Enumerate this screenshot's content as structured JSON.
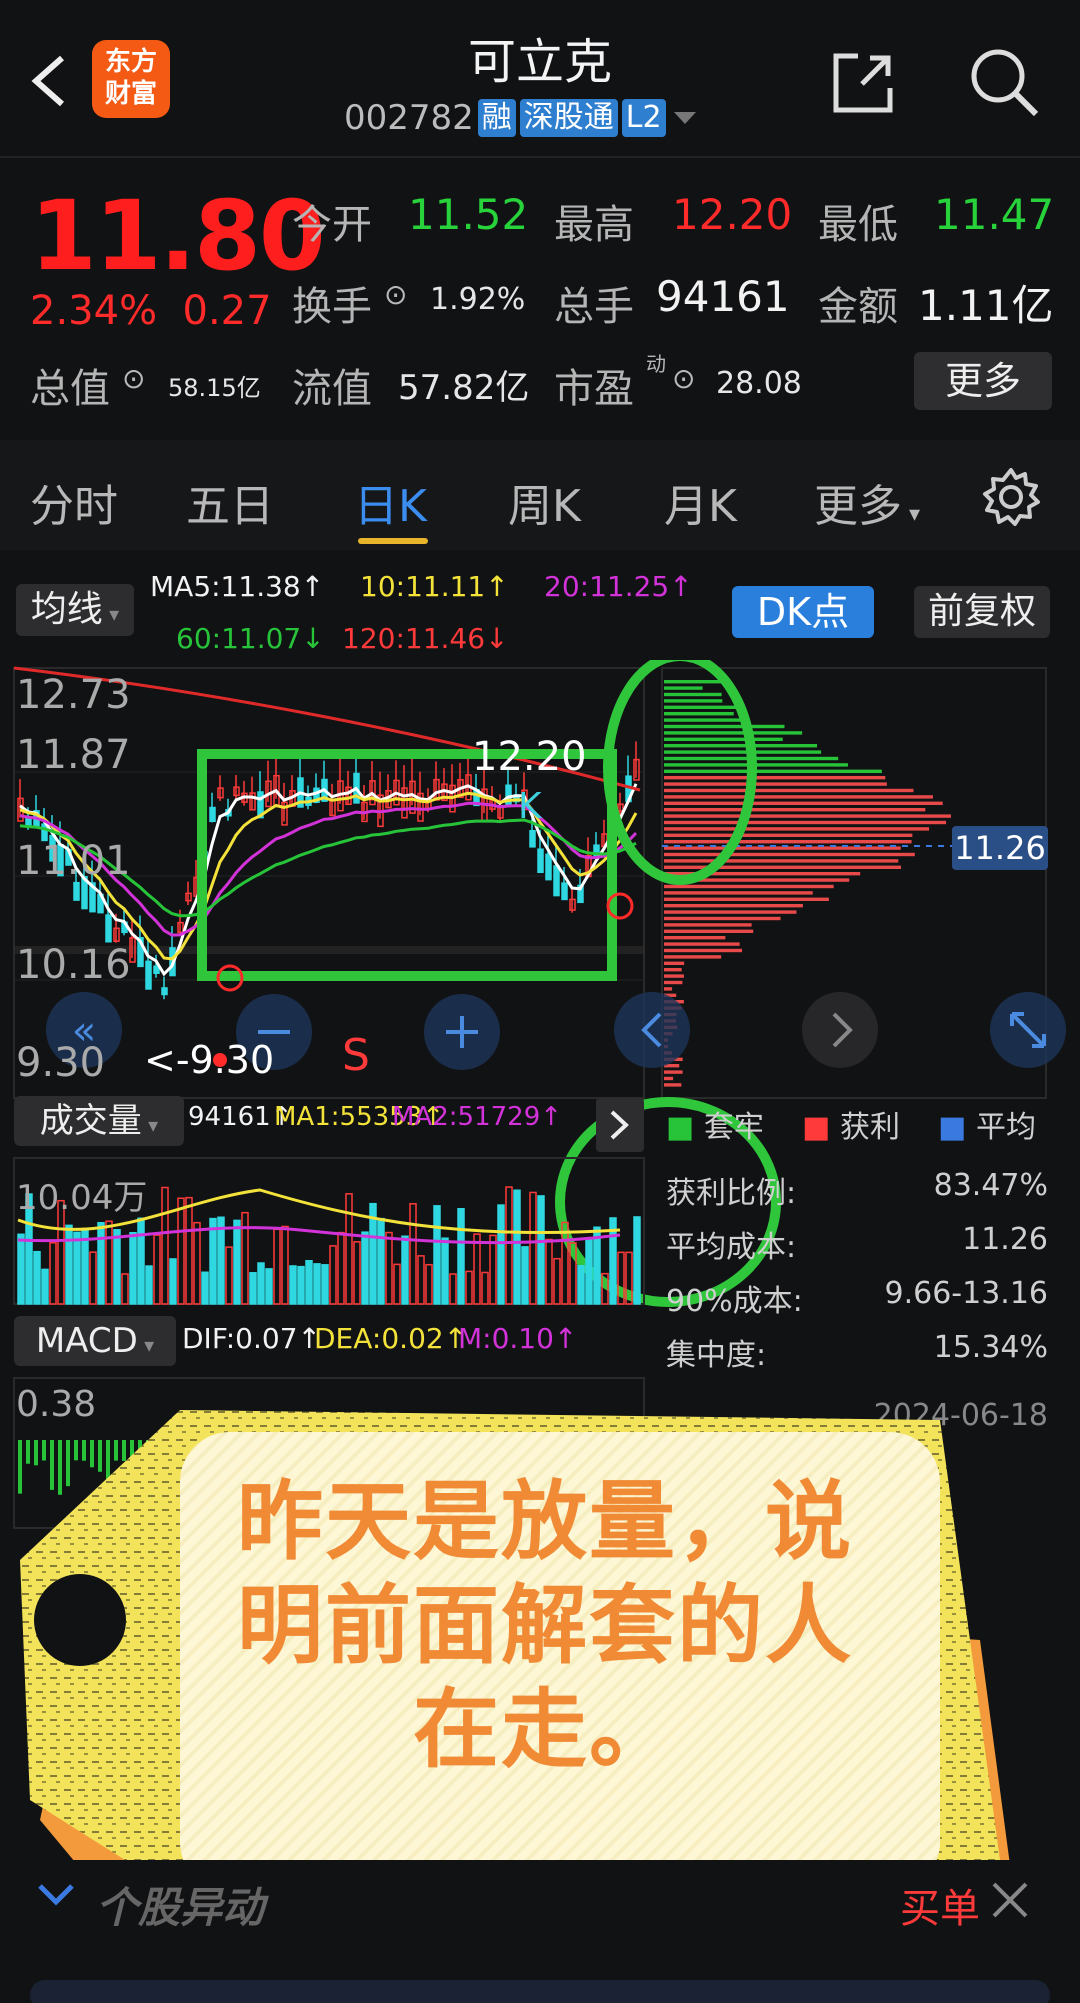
{
  "header": {
    "title": "可立克",
    "code": "002782",
    "tags": [
      "融",
      "深股通",
      "L2"
    ],
    "logo": [
      "东方",
      "财富"
    ]
  },
  "quote": {
    "price": "11.80",
    "pct": "2.34%",
    "chg": "0.27",
    "open_l": "今开",
    "open": "11.52",
    "high_l": "最高",
    "high": "12.20",
    "low_l": "最低",
    "low": "11.47",
    "turn_l": "换手",
    "turn": "1.92%",
    "vol_l": "总手",
    "vol": "94161",
    "amt_l": "金额",
    "amt": "1.11亿",
    "mcap_l": "总值",
    "mcap": "58.15亿",
    "fcap_l": "流值",
    "fcap": "57.82亿",
    "pe_l": "市盈",
    "pe_sup": "动",
    "pe": "28.08",
    "more": "更多"
  },
  "tabs": [
    "分时",
    "五日",
    "日K",
    "周K",
    "月K",
    "更多"
  ],
  "kline": {
    "ma_sel": "均线",
    "ma5": "MA5:11.38↑",
    "ma10": "10:11.11↑",
    "ma20": "20:11.25↑",
    "ma60": "60:11.07↓",
    "ma120": "120:11.46↓",
    "dk": "DK点",
    "fq": "前复权",
    "y": [
      "12.73",
      "11.87",
      "11.01",
      "10.16",
      "9.30"
    ],
    "hi_mark": "12.20",
    "lo_mark": "<-9.30",
    "k_mark": "K",
    "s_mark": "S",
    "cost_tag": "11.26"
  },
  "volume": {
    "sel": "成交量",
    "v": "94161↑",
    "ma1": "MA1:55353↑",
    "ma2": "MA2:51729↑",
    "ymax": "10.04万"
  },
  "macd": {
    "sel": "MACD",
    "dif": "DIF:0.07↑",
    "dea": "DEA:0.02↑",
    "m": "M:0.10↑",
    "ymax": "0.38"
  },
  "chip": {
    "legend": [
      "套牢",
      "获利",
      "平均"
    ],
    "rows": [
      {
        "k": "获利比例:",
        "v": "83.47%"
      },
      {
        "k": "平均成本:",
        "v": "11.26"
      },
      {
        "k": "90%成本:",
        "v": "9.66-13.16"
      },
      {
        "k": "集中度:",
        "v": "15.34%"
      }
    ],
    "date": "2024-06-18"
  },
  "sticker": {
    "text": "昨天是放量，说明前面解套的人在走。",
    "line1": "昨天是放量，说",
    "line2": "明前面解套的人",
    "line3": "在走。"
  },
  "bottom": {
    "label": "个股异动",
    "right": "买单"
  },
  "colors": {
    "up": "#ff2a2a",
    "down": "#27d23a",
    "accent": "#2a7fdc",
    "yellow": "#e8b52a",
    "orange": "#f08a35"
  }
}
